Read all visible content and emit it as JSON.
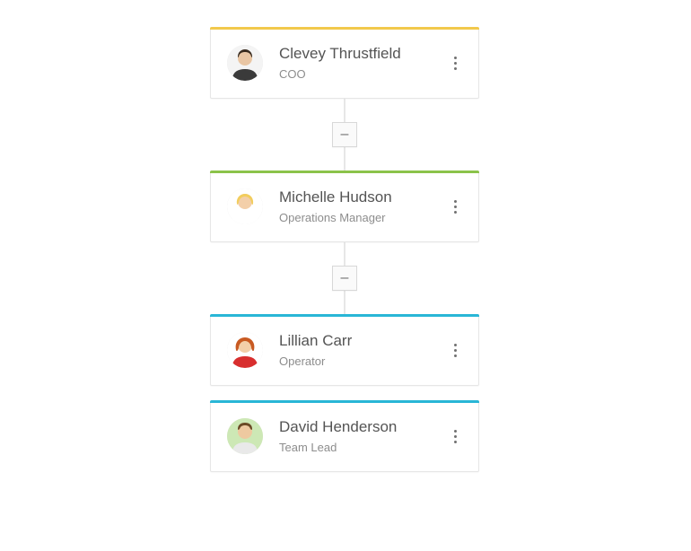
{
  "nodes": [
    {
      "name": "Clevey Thrustfield",
      "role": "COO",
      "accent": "#f2c94c",
      "avatar_bg": "#f4f4f4",
      "avatar_body": "#3a3a3a",
      "avatar_face": "#e9c6a4",
      "avatar_hair": "#3a2c20"
    },
    {
      "name": "Michelle Hudson",
      "role": "Operations Manager",
      "accent": "#8bc34a",
      "avatar_bg": "#ffffff",
      "avatar_body": "#ffffff",
      "avatar_face": "#f3cfa9",
      "avatar_hair": "#f2cd5e"
    },
    {
      "name": "Lillian Carr",
      "role": "Operator",
      "accent": "#29b6d6",
      "avatar_bg": "#ffffff",
      "avatar_body": "#d82e2e",
      "avatar_face": "#f3cfa9",
      "avatar_hair": "#c85a22"
    },
    {
      "name": "David Henderson",
      "role": "Team Lead",
      "accent": "#29b6d6",
      "avatar_bg": "#cde8b5",
      "avatar_body": "#e9e9e9",
      "avatar_face": "#eec9a0",
      "avatar_hair": "#6b4a25"
    }
  ],
  "toggle_label": "–"
}
